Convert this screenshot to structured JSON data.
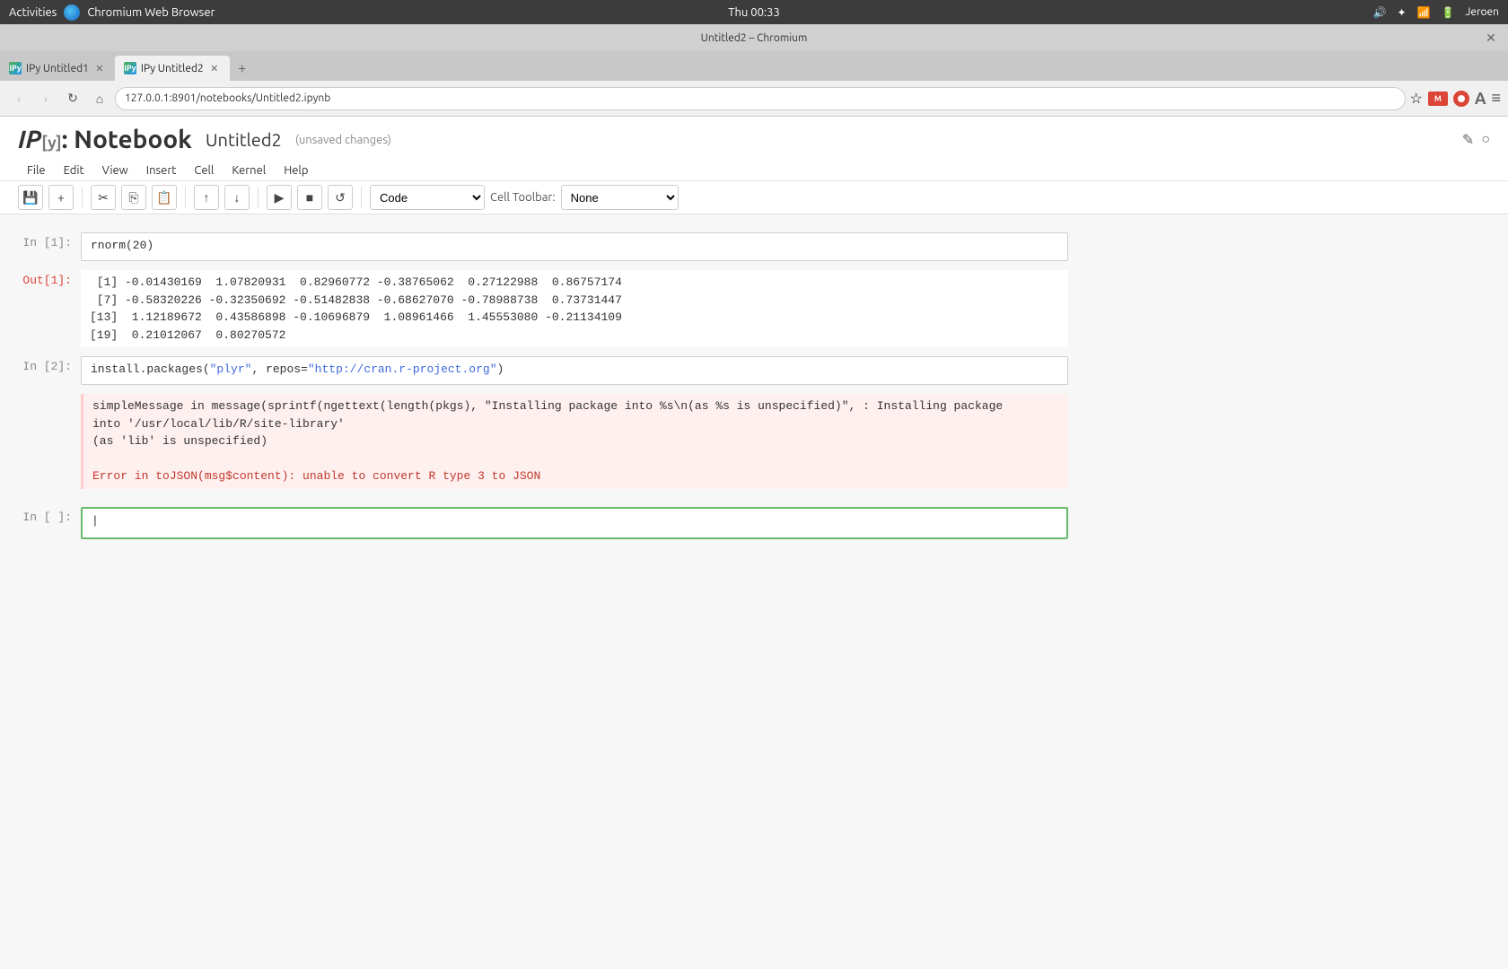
{
  "systemBar": {
    "activities": "Activities",
    "appName": "Chromium Web Browser",
    "time": "Thu 00:33",
    "user": "Jeroen"
  },
  "browserTitle": "Untitled2 – Chromium",
  "tabs": [
    {
      "id": 1,
      "label": "IPy Untitled1",
      "active": false
    },
    {
      "id": 2,
      "label": "IPy Untitled2",
      "active": true
    }
  ],
  "addressBar": {
    "url": "127.0.0.1:8901/notebooks/Untitled2.ipynb"
  },
  "notebook": {
    "logoIP": "IP",
    "logoY": "[y]",
    "logoNB": ": Notebook",
    "title": "Untitled2",
    "unsaved": "(unsaved changes)",
    "menu": [
      "File",
      "Edit",
      "View",
      "Insert",
      "Cell",
      "Kernel",
      "Help"
    ],
    "cellTypeDefault": "Code",
    "cellToolbarLabel": "Cell Toolbar:",
    "cellToolbarDefault": "None",
    "cells": [
      {
        "type": "input",
        "label": "In [1]:",
        "code": "rnorm(20)"
      },
      {
        "type": "output",
        "label": "Out[1]:",
        "lines": [
          " [1] -0.01430169  1.07820931  0.82960772 -0.38765062  0.27122988  0.86757174",
          " [7] -0.58320226 -0.32350692 -0.51482838 -0.68627070 -0.78988738  0.73731447",
          "[13]  1.12189672  0.43586898 -0.10696879  1.08961466  1.45553080 -0.21134109",
          "[19]  0.21012067  0.80270572"
        ]
      },
      {
        "type": "input",
        "label": "In [2]:",
        "codePrefix": "install.packages(",
        "codeStr": "\"plyr\"",
        "codeMid": ", repos=",
        "codeStr2": "\"http://cran.r-project.org\"",
        "codeSuffix": ")"
      },
      {
        "type": "output-error",
        "label": "",
        "messageLines": [
          "simpleMessage in message(sprintf(ngettext(length(pkgs), \"Installing package into %s\\n(as %s is unspecified)\", : Installing package",
          "into '/usr/local/lib/R/site-library'",
          "(as 'lib' is unspecified)"
        ],
        "errorLine": "Error in toJSON(msg$content): unable to convert R type 3 to JSON"
      },
      {
        "type": "active-input",
        "label": "In [ ]:",
        "code": ""
      }
    ]
  }
}
